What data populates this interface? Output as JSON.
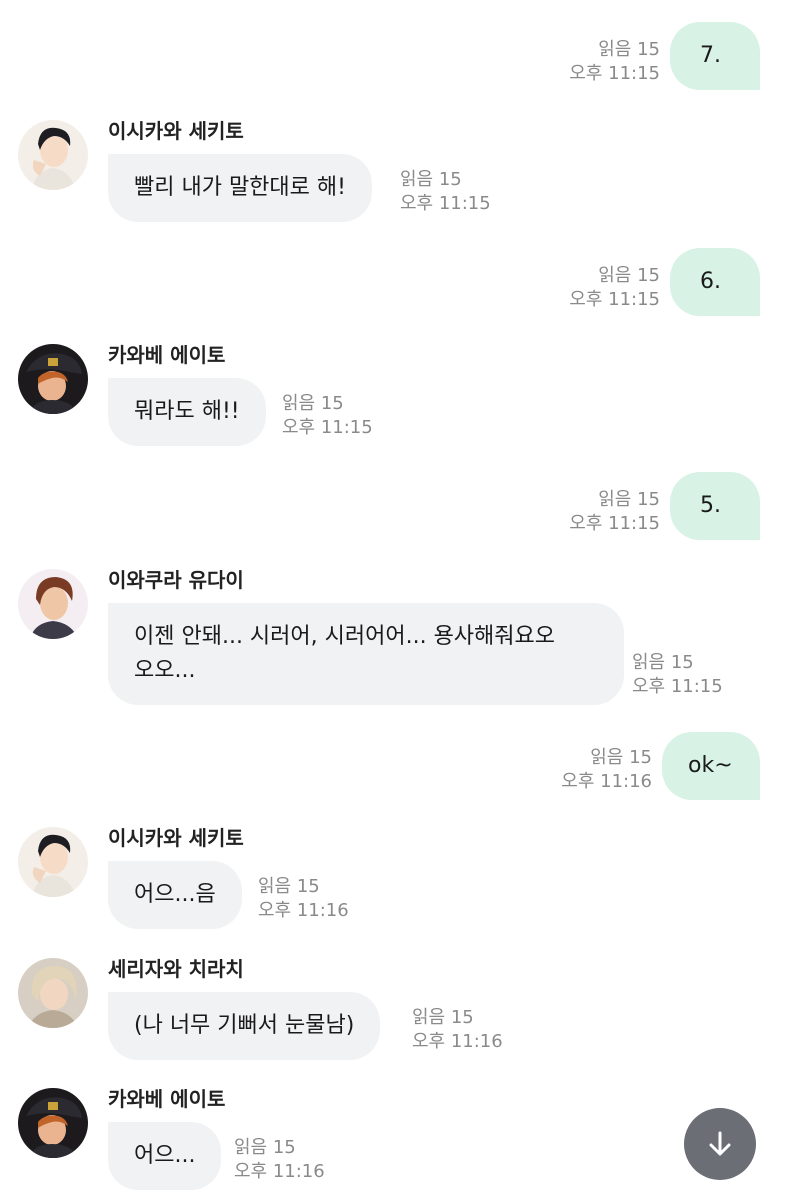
{
  "messages": [
    {
      "id": "m1",
      "direction": "out",
      "text": "7.",
      "read": "읽음 15",
      "time": "오후 11:15"
    },
    {
      "id": "m2",
      "direction": "in",
      "sender": "이시카와 세키토",
      "avatar": "avatar-sekito",
      "text": "빨리 내가 말한대로 해!",
      "read": "읽음 15",
      "time": "오후 11:15"
    },
    {
      "id": "m3",
      "direction": "out",
      "text": "6.",
      "read": "읽음 15",
      "time": "오후 11:15"
    },
    {
      "id": "m4",
      "direction": "in",
      "sender": "카와베 에이토",
      "avatar": "avatar-eito",
      "text": "뭐라도 해!!",
      "read": "읽음 15",
      "time": "오후 11:15"
    },
    {
      "id": "m5",
      "direction": "out",
      "text": "5.",
      "read": "읽음 15",
      "time": "오후 11:15"
    },
    {
      "id": "m6",
      "direction": "in",
      "sender": "이와쿠라 유다이",
      "avatar": "avatar-yudai",
      "text_line1": "이젠 안돼... 시러어, 시러어어... 용사해줘요오",
      "text_line2": "오오...",
      "read": "읽음 15",
      "time": "오후 11:15"
    },
    {
      "id": "m7",
      "direction": "out",
      "text": "ok~",
      "read": "읽음 15",
      "time": "오후 11:16"
    },
    {
      "id": "m8",
      "direction": "in",
      "sender": "이시카와 세키토",
      "avatar": "avatar-sekito",
      "text": "어으...음",
      "read": "읽음 15",
      "time": "오후 11:16"
    },
    {
      "id": "m9",
      "direction": "in",
      "sender": "세리자와 치라치",
      "avatar": "avatar-chirachi",
      "text": "(나 너무 기뻐서 눈물남)",
      "read": "읽음 15",
      "time": "오후 11:16"
    },
    {
      "id": "m10",
      "direction": "in",
      "sender": "카와베 에이토",
      "avatar": "avatar-eito",
      "text": "어으...",
      "read": "읽음 15",
      "time": "오후 11:16"
    }
  ],
  "scroll_button": {
    "icon": "arrow-down-icon",
    "color": "#6b6e75"
  },
  "colors": {
    "outgoing_bubble": "#d9f2e6",
    "incoming_bubble": "#f1f2f4",
    "meta_text": "#8a8a8a"
  }
}
